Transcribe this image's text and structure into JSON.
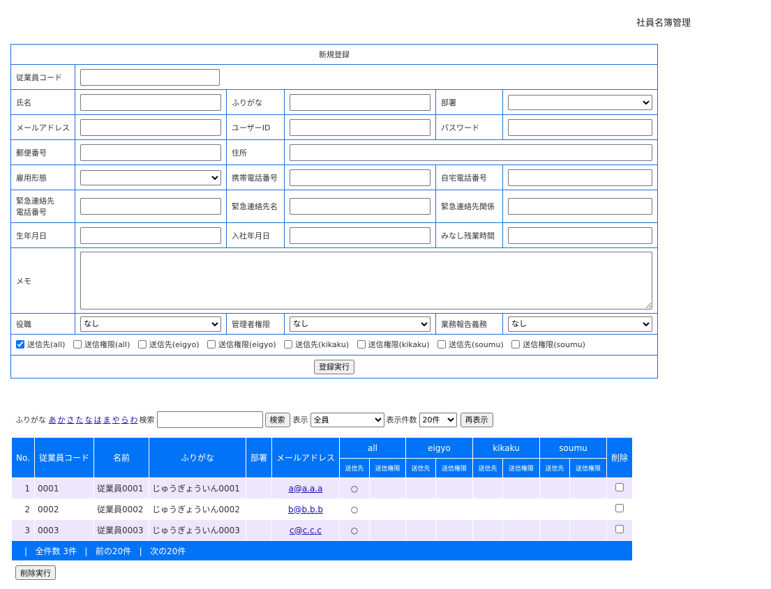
{
  "header": {
    "title": "社員名簿管理"
  },
  "registration": {
    "title": "新規登録",
    "fields": {
      "employee_code": "従業員コード",
      "name": "氏名",
      "furigana": "ふりがな",
      "department": "部署",
      "email": "メールアドレス",
      "user_id": "ユーザーID",
      "password": "パスワード",
      "postal_code": "郵便番号",
      "address": "住所",
      "employment_type": "雇用形態",
      "mobile_phone": "携帯電話番号",
      "home_phone": "自宅電話番号",
      "emergency_phone_line1": "緊急連絡先",
      "emergency_phone_line2": "電話番号",
      "emergency_name": "緊急連絡先名",
      "emergency_relation": "緊急連絡先関係",
      "birth_date": "生年月日",
      "hire_date": "入社年月日",
      "overtime": "みなし残業時間",
      "memo": "メモ",
      "position": "役職",
      "admin_rights": "管理者権限",
      "report_duty": "業務報告義務"
    },
    "selects": {
      "position": "なし",
      "admin_rights": "なし",
      "report_duty": "なし"
    },
    "checkboxes": [
      {
        "label": "送信先(all)",
        "checked": true
      },
      {
        "label": "送信権限(all)",
        "checked": false
      },
      {
        "label": "送信先(eigyo)",
        "checked": false
      },
      {
        "label": "送信権限(eigyo)",
        "checked": false
      },
      {
        "label": "送信先(kikaku)",
        "checked": false
      },
      {
        "label": "送信権限(kikaku)",
        "checked": false
      },
      {
        "label": "送信先(soumu)",
        "checked": false
      },
      {
        "label": "送信権限(soumu)",
        "checked": false
      }
    ],
    "submit_label": "登録実行"
  },
  "search": {
    "furigana_label": "ふりがな",
    "kana": [
      "あ",
      "か",
      "さ",
      "た",
      "な",
      "は",
      "ま",
      "や",
      "ら",
      "わ"
    ],
    "search_label": "検索",
    "search_button": "検索",
    "display_label": "表示",
    "display_value": "全員",
    "count_label": "表示件数",
    "count_value": "20件",
    "refresh_button": "再表示"
  },
  "list": {
    "headers": {
      "no": "No.",
      "code": "従業員コード",
      "name": "名前",
      "furigana": "ふりがな",
      "department": "部署",
      "email": "メールアドレス",
      "delete": "削除"
    },
    "groups": [
      "all",
      "eigyo",
      "kikaku",
      "soumu"
    ],
    "sub_headers": [
      "送信先",
      "送信権限"
    ],
    "rows": [
      {
        "no": "1",
        "code": "0001",
        "name": "従業員0001",
        "furigana": "じゅうぎょういん0001",
        "department": "",
        "email": "a@a.a.a",
        "all_dest": "○"
      },
      {
        "no": "2",
        "code": "0002",
        "name": "従業員0002",
        "furigana": "じゅうぎょういん0002",
        "department": "",
        "email": "b@b.b.b",
        "all_dest": "○"
      },
      {
        "no": "3",
        "code": "0003",
        "name": "従業員0003",
        "furigana": "じゅうぎょういん0003",
        "department": "",
        "email": "c@c.c.c",
        "all_dest": "○"
      }
    ],
    "footer": {
      "sep": "|",
      "total": "全件数 3件",
      "prev": "前の20件",
      "next": "次の20件"
    }
  },
  "delete_button": "削除実行",
  "colors": {
    "accent": "#0073f7",
    "border": "#1e6fd9",
    "row_alt": "#ede6fc",
    "link": "#1a0dab"
  }
}
